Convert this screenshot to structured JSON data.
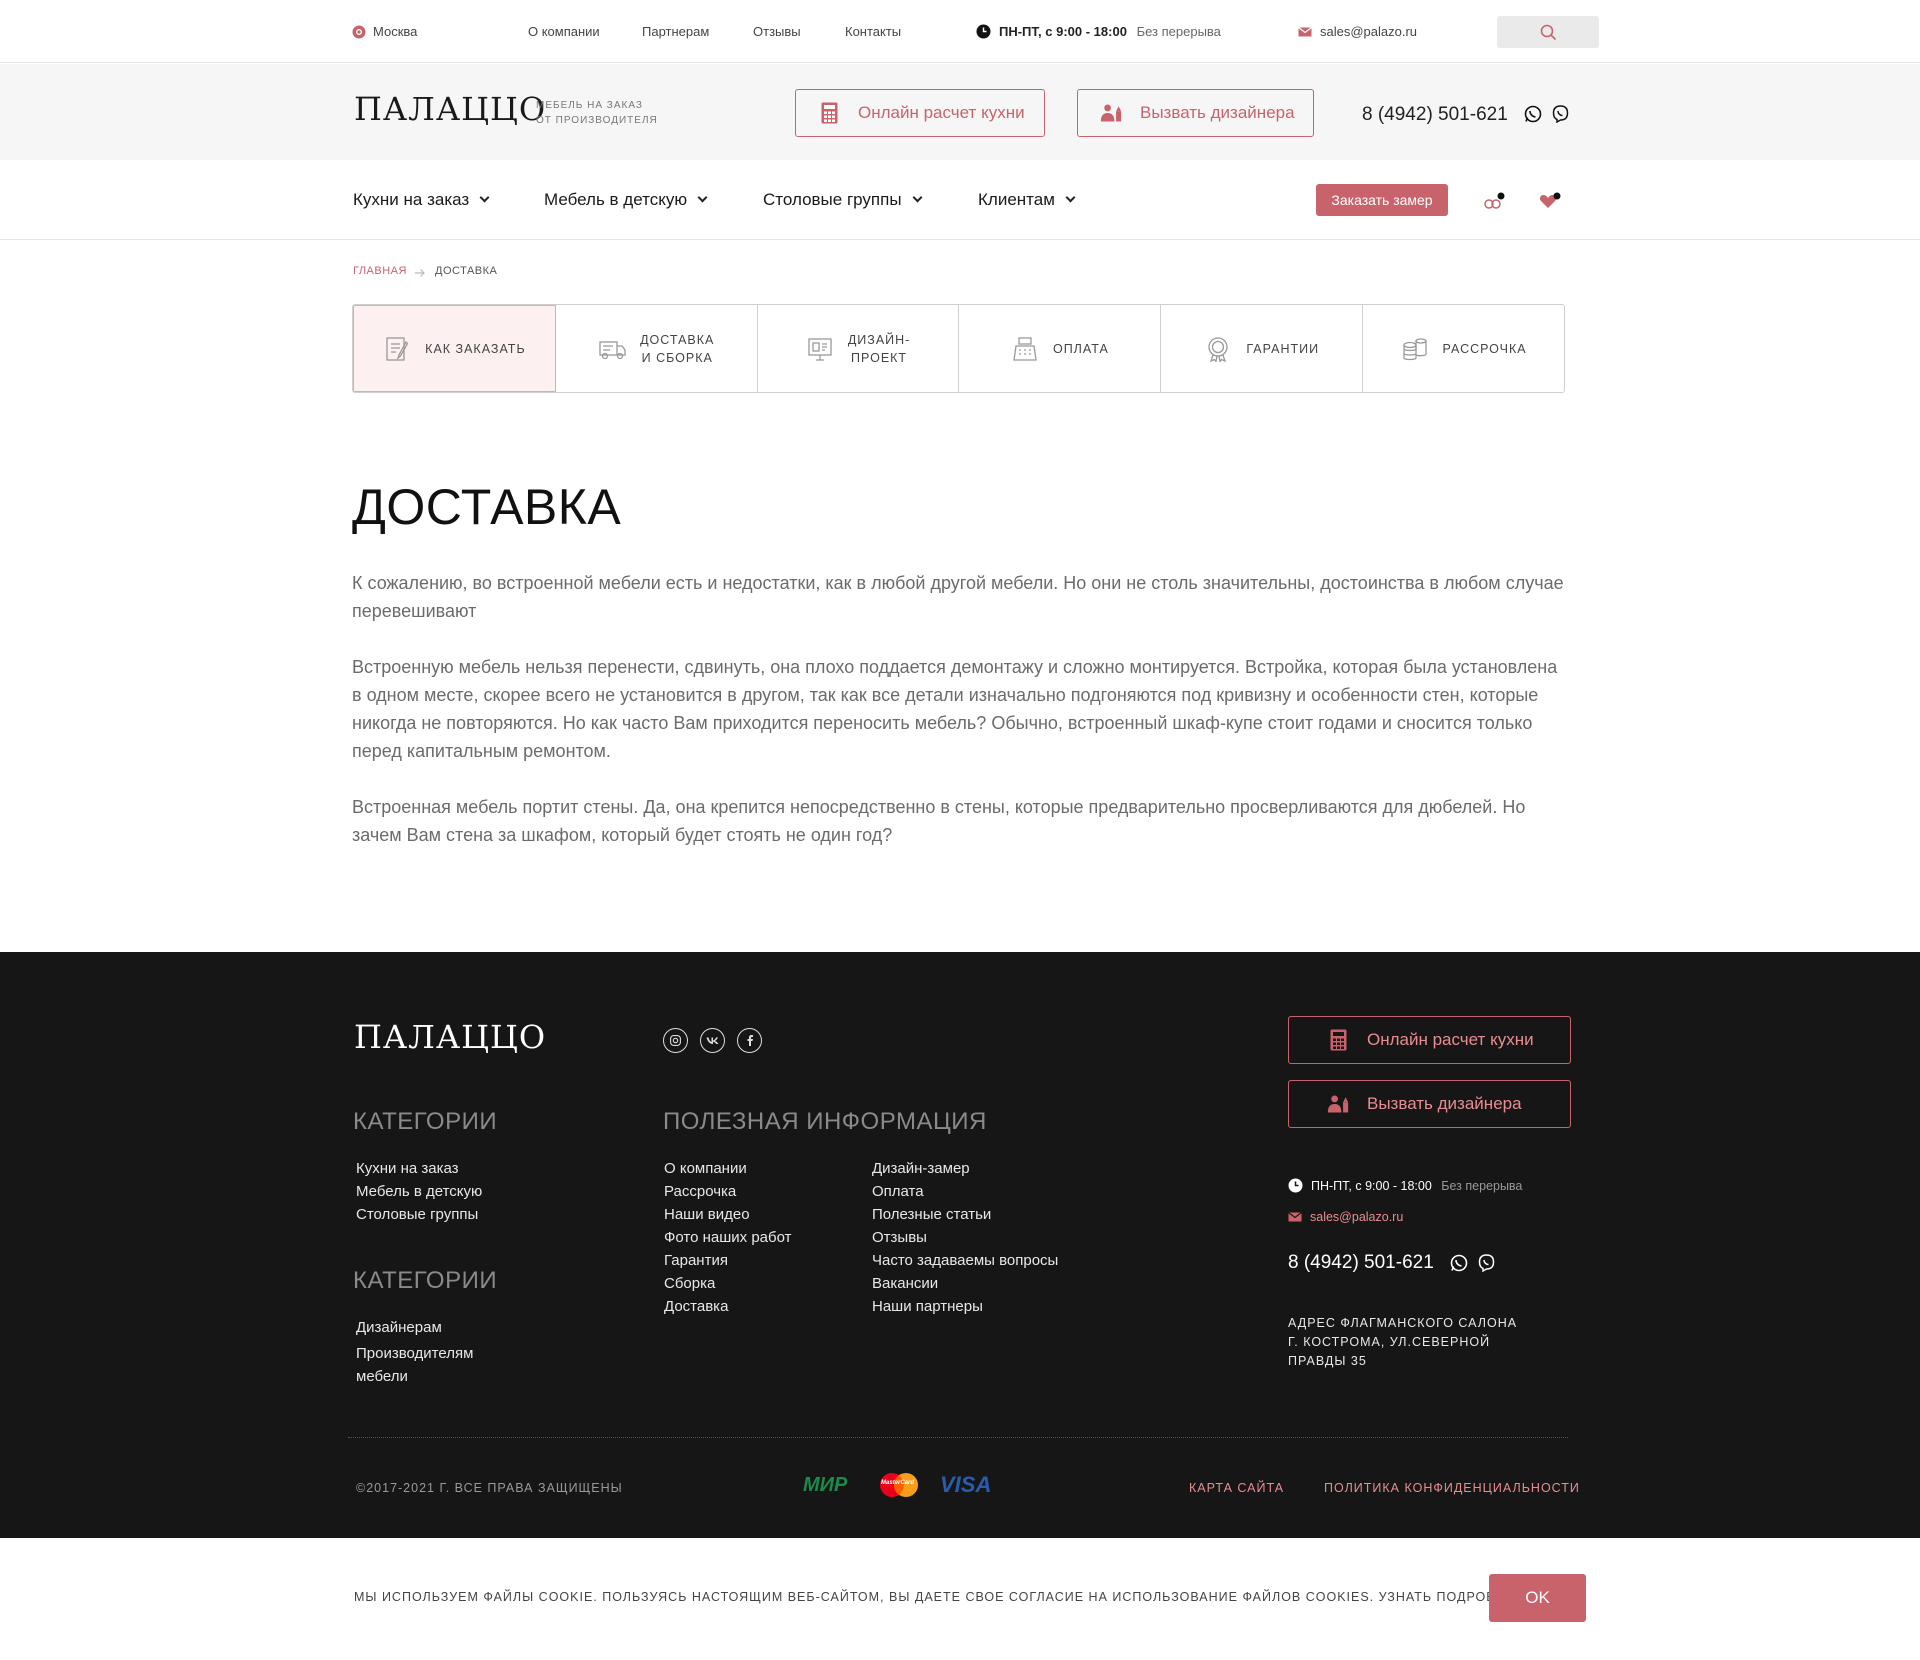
{
  "topbar": {
    "city": "Москва",
    "links": [
      "О компании",
      "Партнерам",
      "Отзывы",
      "Контакты"
    ],
    "hours": "ПН-ПТ, с 9:00 - 18:00",
    "hours_note": "Без перерыва",
    "email": "sales@palazo.ru"
  },
  "header": {
    "logo": "ПАЛАЦЦО",
    "tagline_line1": "МЕБЕЛЬ НА ЗАКАЗ",
    "tagline_line2": "ОТ ПРОИЗВОДИТЕЛЯ",
    "calc_button": "Онлайн расчет кухни",
    "designer_button": "Вызвать дизайнера",
    "phone": "8 (4942) 501-621"
  },
  "nav": {
    "items": [
      "Кухни на заказ",
      "Мебель в детскую",
      "Столовые группы",
      "Клиентам"
    ],
    "order_button": "Заказать замер"
  },
  "breadcrumb": {
    "home": "ГЛАВНАЯ",
    "current": "ДОСТАВКА"
  },
  "tabs": [
    {
      "line1": "КАК ЗАКАЗАТЬ",
      "line2": "",
      "icon": "order-icon"
    },
    {
      "line1": "ДОСТАВКА",
      "line2": "И СБОРКА",
      "icon": "truck-icon"
    },
    {
      "line1": "ДИЗАЙН-",
      "line2": "ПРОЕКТ",
      "icon": "design-icon"
    },
    {
      "line1": "ОПЛАТА",
      "line2": "",
      "icon": "cash-register-icon"
    },
    {
      "line1": "ГАРАНТИИ",
      "line2": "",
      "icon": "guarantee-icon"
    },
    {
      "line1": "РАССРОЧКА",
      "line2": "",
      "icon": "coins-icon"
    }
  ],
  "content": {
    "title": "ДОСТАВКА",
    "paragraphs": [
      "К сожалению, во встроенной мебели есть и недостатки, как в любой другой мебели. Но они не столь значительны, достоинства в любом случае перевешивают",
      "Встроенную мебель нельзя перенести, сдвинуть, она плохо поддается демонтажу и сложно монтируется. Встройка, которая была установлена в одном месте, скорее всего не установится в другом, так как все детали изначально подгоняются под кривизну и особенности стен, которые никогда не повторяются. Но как часто Вам приходится переносить мебель? Обычно, встроенный шкаф-купе стоит годами и сносится только перед капитальным ремонтом.",
      "Встроенная мебель портит стены. Да, она крепится непосредственно в стены, которые предварительно просверливаются для дюбелей. Но зачем Вам стена за шкафом, который будет стоять не один год?"
    ]
  },
  "footer": {
    "logo": "ПАЛАЦЦО",
    "categories_title": "КАТЕГОРИИ",
    "categories": [
      "Кухни на заказ",
      "Мебель в детскую",
      "Столовые группы"
    ],
    "categories2_title": "КАТЕГОРИИ",
    "categories2": [
      "Дизайнерам",
      "Производителям мебели"
    ],
    "info_title": "ПОЛЕЗНАЯ ИНФОРМАЦИЯ",
    "info_col1": [
      "О компании",
      "Рассрочка",
      "Наши видео",
      "Фото наших работ",
      "Гарантия",
      "Сборка",
      "Доставка"
    ],
    "info_col2": [
      "Дизайн-замер",
      "Оплата",
      "Полезные статьи",
      "Отзывы",
      "Часто задаваемы вопросы",
      "Вакансии",
      "Наши партнеры"
    ],
    "calc_button": "Онлайн расчет кухни",
    "designer_button": "Вызвать дизайнера",
    "hours": "ПН-ПТ, с 9:00 - 18:00",
    "hours_note": "Без перерыва",
    "email": "sales@palazo.ru",
    "phone": "8 (4942) 501-621",
    "address_line1": "АДРЕС ФЛАГМАНСКОГО САЛОНА",
    "address_line2": "Г. КОСТРОМА, УЛ.СЕВЕРНОЙ",
    "address_line3": "ПРАВДЫ 35",
    "copyright": "©2017-2021 Г. ВСЕ ПРАВА ЗАЩИЩЕНЫ",
    "payments": [
      "МИР",
      "MasterCard",
      "VISA"
    ],
    "sitemap": "КАРТА САЙТА",
    "privacy": "ПОЛИТИКА КОНФИДЕНЦИАЛЬНОСТИ"
  },
  "cookie": {
    "text": "МЫ ИСПОЛЬЗУЕМ ФАЙЛЫ COOKIE. ПОЛЬЗУЯСЬ НАСТОЯЩИМ ВЕБ-САЙТОМ, ВЫ ДАЕТЕ СВОЕ СОГЛАСИЕ НА ИСПОЛЬЗОВАНИЕ ФАЙЛОВ COOKIES. УЗНАТЬ ПОДРОБНЕЕ",
    "ok": "OK"
  },
  "colors": {
    "accent": "#c9636b",
    "footer_bg": "#161616",
    "header_bg": "#f6f6f6"
  }
}
